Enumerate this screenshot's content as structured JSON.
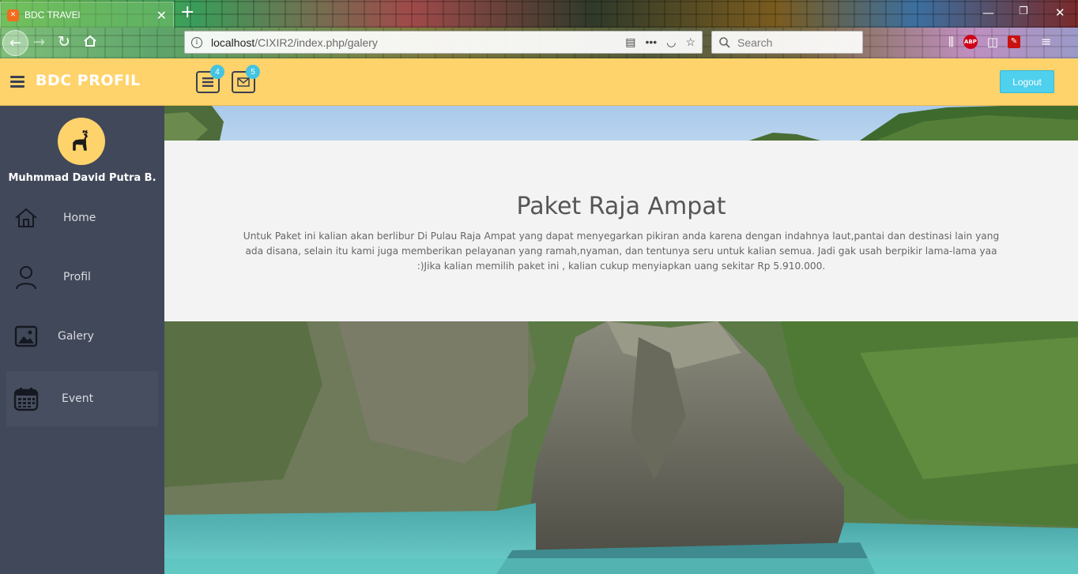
{
  "browser": {
    "tab_title": "BDC TRAVEl",
    "url_host": "localhost",
    "url_path": "/CIXIR2/index.php/galery",
    "search_placeholder": "Search"
  },
  "header": {
    "brand": "BDC PROFIL",
    "list_badge": "4",
    "mail_badge": "5",
    "logout_label": "Logout",
    "accent_color": "#ffd36b"
  },
  "sidebar": {
    "user_name": "Muhmmad David Putra B.",
    "items": [
      {
        "label": "Home",
        "icon": "home-icon"
      },
      {
        "label": "Profil",
        "icon": "user-icon"
      },
      {
        "label": "Galery",
        "icon": "image-icon"
      },
      {
        "label": "Event",
        "icon": "calendar-icon"
      }
    ],
    "active": "Event",
    "background": "#414859"
  },
  "main": {
    "title": "Paket Raja Ampat",
    "description": "Untuk Paket ini kalian akan berlibur Di Pulau Raja Ampat yang dapat menyegarkan pikiran anda karena dengan indahnya laut,pantai dan destinasi lain yang ada disana, selain itu kami juga memberikan pelayanan yang ramah,nyaman, dan tentunya seru untuk kalian semua. Jadi gak usah berpikir lama-lama yaa :)Jika kalian memilih paket ini , kalian cukup menyiapkan uang sekitar Rp 5.910.000."
  }
}
